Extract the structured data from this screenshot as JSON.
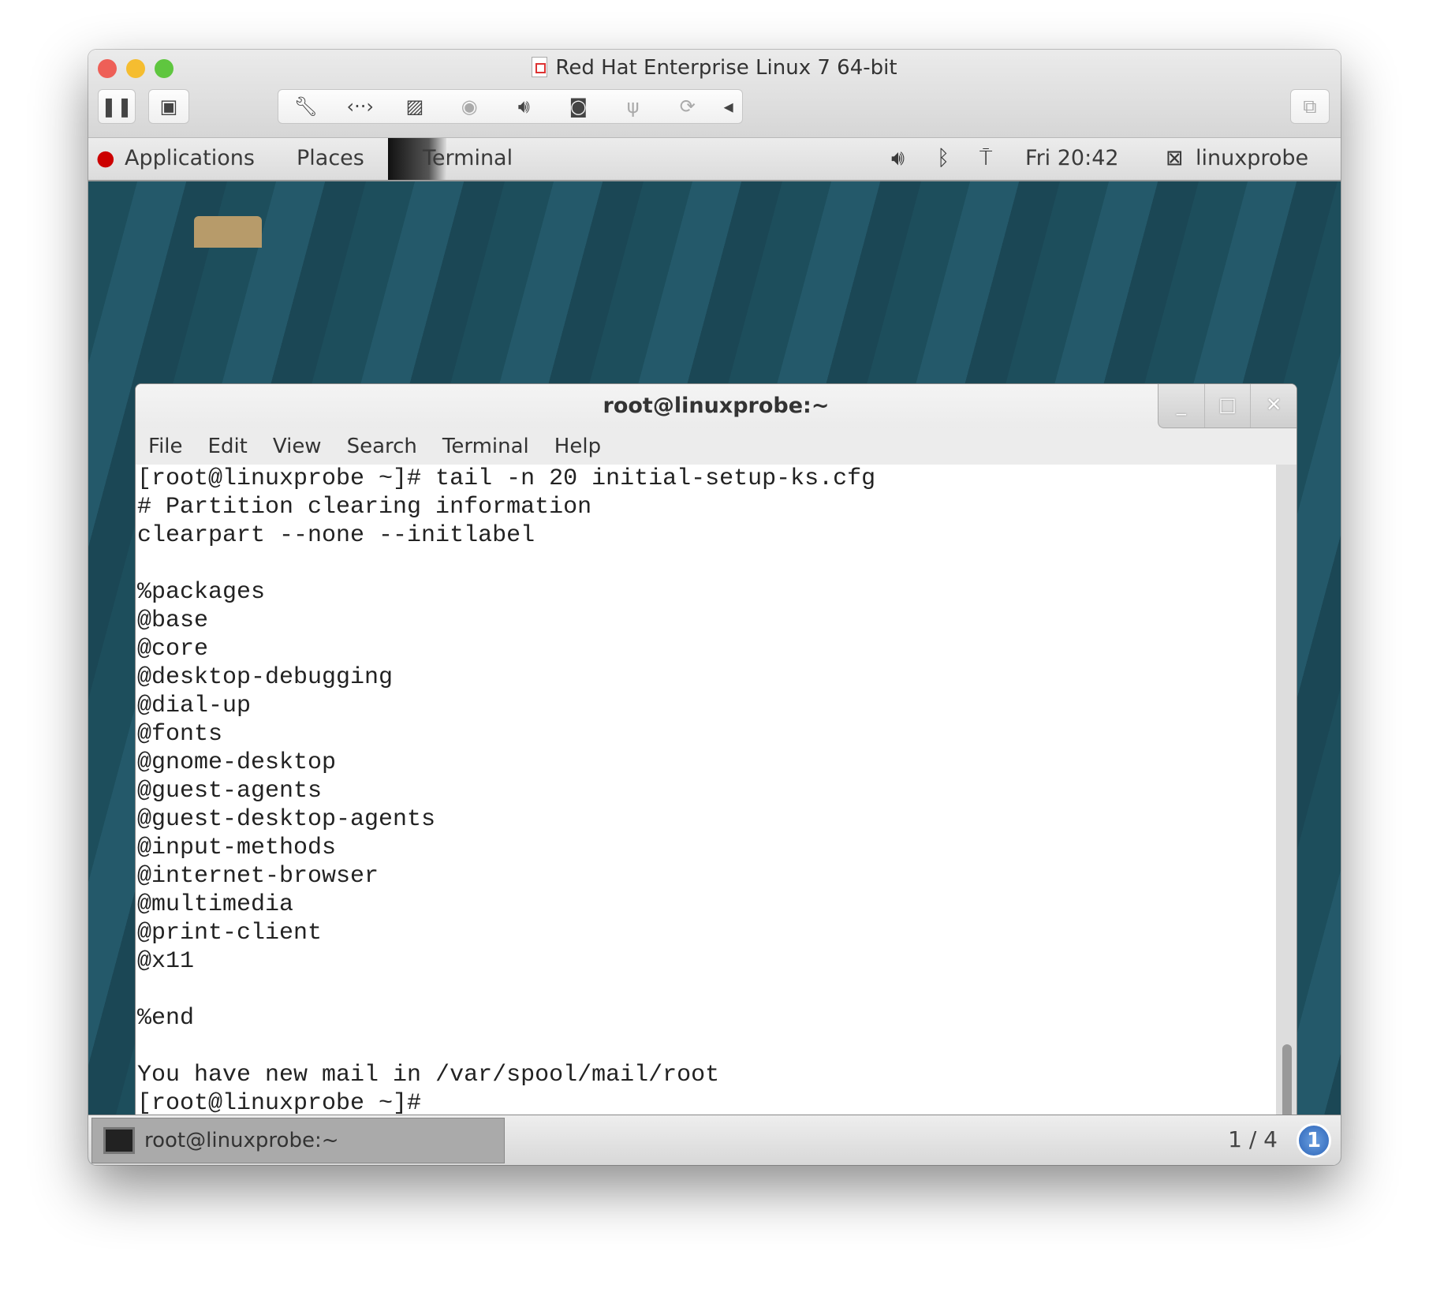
{
  "vm_window": {
    "title": "Red Hat Enterprise Linux 7 64-bit",
    "toolbar": [
      {
        "icon": "pause-icon"
      },
      {
        "icon": "snapshot-icon"
      },
      {
        "icon": "wrench-icon"
      },
      {
        "icon": "network-icon"
      },
      {
        "icon": "hard-disk-icon"
      },
      {
        "icon": "cd-icon"
      },
      {
        "icon": "sound-icon"
      },
      {
        "icon": "camera-icon"
      },
      {
        "icon": "usb-icon"
      },
      {
        "icon": "sync-icon"
      },
      {
        "icon": "collapse-arrow-icon"
      },
      {
        "icon": "fullscreen-icon"
      }
    ]
  },
  "gnome_bar": {
    "applications": "Applications",
    "places": "Places",
    "active_app": "Terminal",
    "clock": "Fri 20:42",
    "user": "linuxprobe"
  },
  "terminal": {
    "title": "root@linuxprobe:~",
    "menu": [
      "File",
      "Edit",
      "View",
      "Search",
      "Terminal",
      "Help"
    ],
    "lines": [
      "[root@linuxprobe ~]# tail -n 20 initial-setup-ks.cfg",
      "# Partition clearing information",
      "clearpart --none --initlabel",
      "",
      "%packages",
      "@base",
      "@core",
      "@desktop-debugging",
      "@dial-up",
      "@fonts",
      "@gnome-desktop",
      "@guest-agents",
      "@guest-desktop-agents",
      "@input-methods",
      "@internet-browser",
      "@multimedia",
      "@print-client",
      "@x11",
      "",
      "%end",
      "",
      "You have new mail in /var/spool/mail/root",
      "[root@linuxprobe ~]# ",
      "[root@linuxprobe ~]# "
    ]
  },
  "panel": {
    "task": "root@linuxprobe:~",
    "workspace": "1 / 4",
    "notifications": "1"
  }
}
